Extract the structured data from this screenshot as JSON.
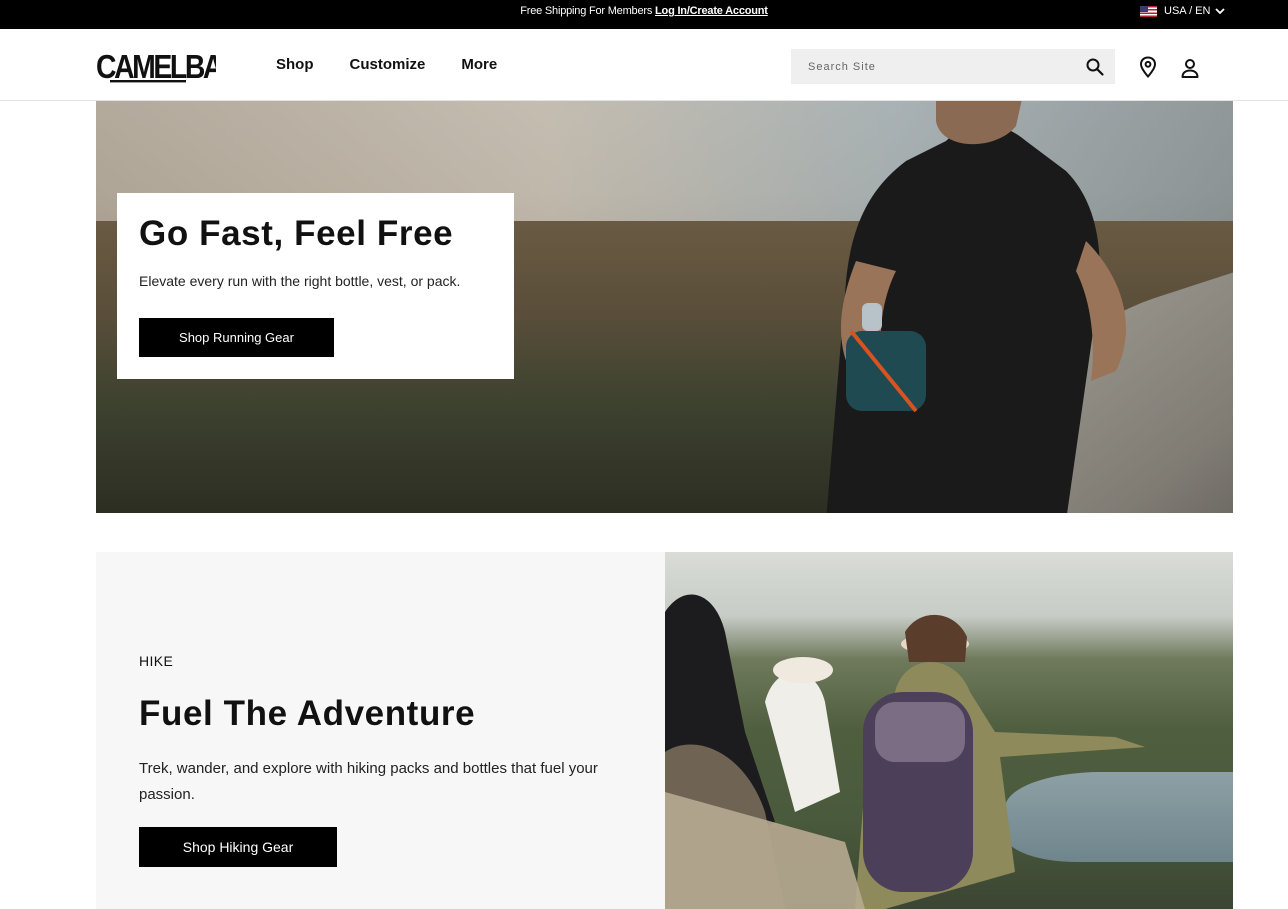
{
  "promo": {
    "text": "Free Shipping For Members",
    "link": "Log In/Create Account"
  },
  "locale": {
    "label": "USA / EN"
  },
  "header": {
    "logo_text": "CAMELBAK",
    "nav": [
      "Shop",
      "Customize",
      "More"
    ],
    "search_placeholder": "Search Site"
  },
  "hero": {
    "title": "Go Fast, Feel Free",
    "subtitle": "Elevate every run with the right bottle, vest, or pack.",
    "cta": "Shop Running Gear"
  },
  "hike": {
    "eyebrow": "HIKE",
    "title": "Fuel The Adventure",
    "subtitle": "Trek, wander, and explore with hiking packs and bottles that fuel your passion.",
    "cta": "Shop Hiking Gear"
  },
  "colors": {
    "black": "#000000",
    "panel": "#f7f7f7",
    "search_bg": "#efefef"
  },
  "icons": [
    "us-flag-icon",
    "chevron-down-icon",
    "search-icon",
    "location-pin-icon",
    "account-icon"
  ]
}
